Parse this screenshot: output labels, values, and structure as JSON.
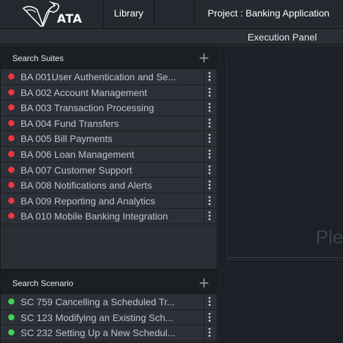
{
  "app": {
    "logo_text": "ATA",
    "nav_library": "Library",
    "project_title": "Project : Banking Application",
    "exec_panel_title": "Execution Panel",
    "exec_placeholder": "Ple"
  },
  "colors": {
    "status_red": "#f2353d",
    "status_green": "#3ed35a"
  },
  "suites": {
    "title": "Search Suites",
    "add_icon": "plus-icon",
    "items": [
      {
        "label": "BA 001User Authentication and Se...",
        "status": "red"
      },
      {
        "label": "BA 002 Account Management",
        "status": "red"
      },
      {
        "label": "BA 003 Transaction Processing",
        "status": "red"
      },
      {
        "label": "BA 004 Fund Transfers",
        "status": "red"
      },
      {
        "label": "BA 005 Bill Payments",
        "status": "red"
      },
      {
        "label": "BA 006 Loan Management",
        "status": "red"
      },
      {
        "label": "BA 007 Customer Support",
        "status": "red"
      },
      {
        "label": "BA 008 Notifications and Alerts",
        "status": "red"
      },
      {
        "label": "BA 009 Reporting and Analytics",
        "status": "red"
      },
      {
        "label": "BA 010 Mobile Banking Integration",
        "status": "red"
      }
    ]
  },
  "scenarios": {
    "title": "Search Scenario",
    "add_icon": "plus-icon",
    "items": [
      {
        "label": "SC 759 Cancelling a Scheduled Tr...",
        "status": "green"
      },
      {
        "label": "SC 123 Modifying an Existing Sch...",
        "status": "green"
      },
      {
        "label": "SC 232 Setting Up a New Schedul...",
        "status": "green"
      }
    ]
  }
}
